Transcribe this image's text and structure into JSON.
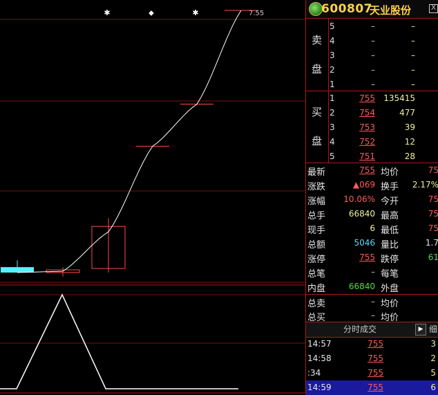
{
  "stock": {
    "code": "600807",
    "name": "天业股份",
    "close_label": "X"
  },
  "chart_data": {
    "type": "candlestick",
    "top_right_label": "7.55",
    "candles": [
      {
        "open": 5.66,
        "close": 5.62,
        "high": 5.71,
        "low": 5.62,
        "color": "cyan"
      },
      {
        "open": 5.62,
        "close": 5.64,
        "high": 5.66,
        "low": 5.59,
        "color": "red"
      },
      {
        "open": 5.65,
        "close": 5.96,
        "high": 6.02,
        "low": 5.62,
        "color": "red"
      },
      {
        "open": 6.55,
        "close": 6.55,
        "high": 6.55,
        "low": 6.55,
        "color": "red"
      },
      {
        "open": 6.86,
        "close": 6.86,
        "high": 6.86,
        "low": 6.86,
        "color": "red"
      },
      {
        "open": 7.55,
        "close": 7.55,
        "high": 7.55,
        "low": 7.55,
        "color": "red"
      }
    ],
    "ma_line": [
      5.62,
      5.63,
      5.92,
      6.55,
      6.86,
      7.55
    ],
    "volume": [
      0,
      1,
      0,
      0,
      0,
      0
    ],
    "markers": [
      "✱",
      "⬥",
      "✱"
    ]
  },
  "orderbook": {
    "sell_label_1": "卖",
    "sell_label_2": "盘",
    "buy_label_1": "买",
    "buy_label_2": "盘",
    "sell": [
      {
        "level": "5",
        "price": "–",
        "vol": "–"
      },
      {
        "level": "4",
        "price": "–",
        "vol": "–"
      },
      {
        "level": "3",
        "price": "–",
        "vol": "–"
      },
      {
        "level": "2",
        "price": "–",
        "vol": "–"
      },
      {
        "level": "1",
        "price": "–",
        "vol": "–"
      }
    ],
    "buy": [
      {
        "level": "1",
        "price": "755",
        "vol": "135415"
      },
      {
        "level": "2",
        "price": "754",
        "vol": "477"
      },
      {
        "level": "3",
        "price": "753",
        "vol": "39"
      },
      {
        "level": "4",
        "price": "752",
        "vol": "12"
      },
      {
        "level": "5",
        "price": "751",
        "vol": "28"
      }
    ]
  },
  "stats": [
    {
      "k1": "最新",
      "v1": "755",
      "c1": "red",
      "k2": "均价",
      "v2": "75",
      "c2": "red"
    },
    {
      "k1": "涨跌",
      "v1": "▲069",
      "c1": "red",
      "k2": "换手",
      "v2": "2.17%",
      "c2": "yellow"
    },
    {
      "k1": "涨幅",
      "v1": "10.06%",
      "c1": "red",
      "k2": "今开",
      "v2": "75",
      "c2": "red"
    },
    {
      "k1": "总手",
      "v1": "66840",
      "c1": "yellow",
      "k2": "最高",
      "v2": "75",
      "c2": "red"
    },
    {
      "k1": "现手",
      "v1": "6",
      "c1": "yellow",
      "k2": "最低",
      "v2": "75",
      "c2": "red"
    },
    {
      "k1": "总额",
      "v1": "5046",
      "c1": "cyan",
      "k2": "量比",
      "v2": "1.7",
      "c2": "white"
    },
    {
      "k1": "涨停",
      "v1": "755",
      "c1": "red",
      "k2": "跌停",
      "v2": "61",
      "c2": "green"
    },
    {
      "k1": "总笔",
      "v1": "–",
      "c1": "dash",
      "k2": "每笔",
      "v2": "",
      "c2": "white"
    },
    {
      "k1": "内盘",
      "v1": "66840",
      "c1": "green",
      "k2": "外盘",
      "v2": "",
      "c2": "white"
    },
    {
      "k1": "总卖",
      "v1": "–",
      "c1": "dash",
      "k2": "均价",
      "v2": "",
      "c2": "white"
    },
    {
      "k1": "总买",
      "v1": "–",
      "c1": "dash",
      "k2": "均价",
      "v2": "",
      "c2": "white"
    }
  ],
  "ticks_tab": {
    "label": "分时成交",
    "arrow": "▶",
    "fine": "细"
  },
  "ticks": [
    {
      "time": "14:57",
      "price": "755",
      "vol": "3"
    },
    {
      "time": "14:58",
      "price": "755",
      "vol": "2"
    },
    {
      "time": ":34",
      "price": "755",
      "vol": "5"
    },
    {
      "time": "14:59",
      "price": "755",
      "vol": "6"
    }
  ]
}
